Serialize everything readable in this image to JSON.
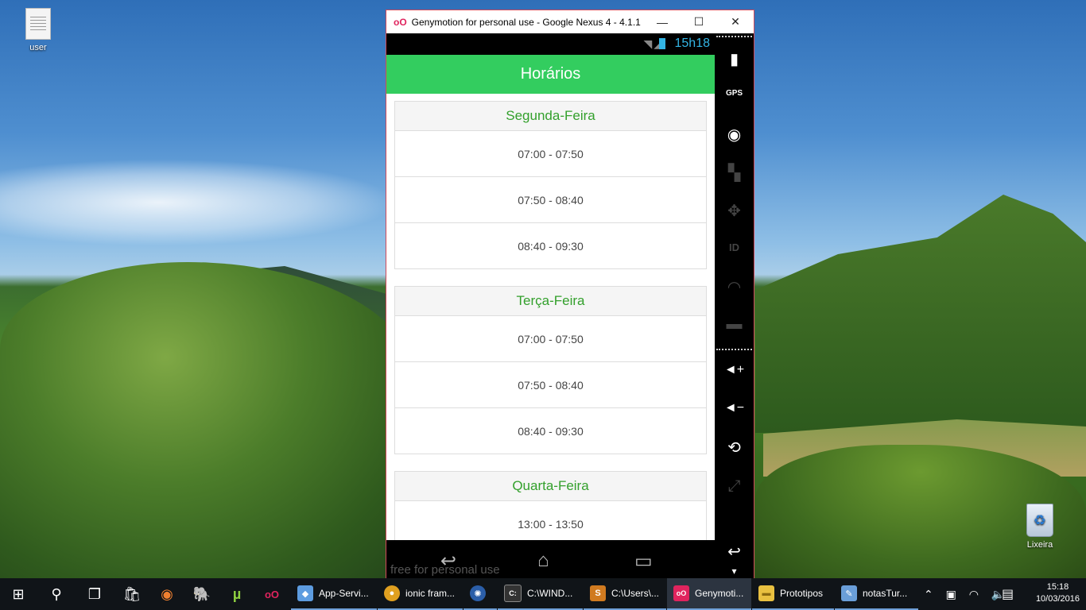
{
  "desktop": {
    "icons": [
      {
        "label": "user",
        "icon": "document-icon"
      },
      {
        "label": "Lixeira",
        "icon": "recycle-bin-icon"
      }
    ]
  },
  "window": {
    "app_icon": "oO",
    "title": "Genymotion for personal use - Google Nexus 4 - 4.1.1 ...",
    "minimize": "—",
    "maximize": "☐",
    "close": "✕"
  },
  "phone": {
    "status": {
      "time": "15h18",
      "icons": "wifi signal battery"
    },
    "header_title": "Horários",
    "days": [
      {
        "name": "Segunda-Feira",
        "slots": [
          "07:00 - 07:50",
          "07:50 - 08:40",
          "08:40 - 09:30"
        ]
      },
      {
        "name": "Terça-Feira",
        "slots": [
          "07:00 - 07:50",
          "07:50 - 08:40",
          "08:40 - 09:30"
        ]
      },
      {
        "name": "Quarta-Feira",
        "slots": [
          "13:00 - 13:50"
        ]
      }
    ],
    "nav": {
      "back": "↩",
      "home": "⌂",
      "recents": "▭"
    },
    "watermark": "free for personal use"
  },
  "sidebar": {
    "buttons": [
      {
        "name": "battery-icon",
        "glyph": "▮",
        "enabled": true
      },
      {
        "name": "gps-icon",
        "glyph": "GPS",
        "enabled": true
      },
      {
        "name": "camera-icon",
        "glyph": "◉",
        "enabled": true
      },
      {
        "name": "video-capture-icon",
        "glyph": "▚",
        "enabled": false
      },
      {
        "name": "dpad-icon",
        "glyph": "✥",
        "enabled": false
      },
      {
        "name": "device-id-icon",
        "glyph": "ID",
        "enabled": false
      },
      {
        "name": "network-icon",
        "glyph": "◠",
        "enabled": false
      },
      {
        "name": "sms-icon",
        "glyph": "▬",
        "enabled": false
      },
      {
        "name": "volume-up-icon",
        "glyph": "◄+",
        "enabled": true
      },
      {
        "name": "volume-down-icon",
        "glyph": "◄−",
        "enabled": true
      },
      {
        "name": "rotate-icon",
        "glyph": "⟲",
        "enabled": true
      },
      {
        "name": "pixel-perfect-icon",
        "glyph": "⤢",
        "enabled": false
      },
      {
        "name": "back-icon",
        "glyph": "↩",
        "enabled": true
      },
      {
        "name": "menu-icon",
        "glyph": "▾",
        "enabled": true
      }
    ]
  },
  "taskbar": {
    "start": "⊞",
    "search": "⚲",
    "task_view": "❐",
    "pinned": [
      {
        "name": "store-icon",
        "glyph": "🛍"
      },
      {
        "name": "firefox-icon",
        "glyph": "◉"
      },
      {
        "name": "postgres-icon",
        "glyph": "🐘"
      },
      {
        "name": "utorrent-icon",
        "glyph": "µ"
      },
      {
        "name": "genymotion-pinned-icon",
        "glyph": "oO"
      }
    ],
    "apps": [
      {
        "label": "App-Servi...",
        "icon": "virtualbox-icon",
        "glyph": "◆",
        "color": "#5d9ce0",
        "active": false
      },
      {
        "label": "ionic fram...",
        "icon": "chrome-icon",
        "glyph": "●",
        "color": "#e0a020",
        "active": false
      },
      {
        "label": "",
        "icon": "sourcetree-icon",
        "glyph": "✺",
        "color": "#2b5ea8",
        "active": false
      },
      {
        "label": "C:\\WIND...",
        "icon": "cmd-icon",
        "glyph": "C:",
        "color": "#333333",
        "active": false
      },
      {
        "label": "C:\\Users\\...",
        "icon": "sublime-icon",
        "glyph": "S",
        "color": "#d07a20",
        "active": false
      },
      {
        "label": "Genymoti...",
        "icon": "genymotion-icon",
        "glyph": "oO",
        "color": "#e0245e",
        "active": true
      },
      {
        "label": "Prototipos",
        "icon": "folder-icon",
        "glyph": "▬",
        "color": "#e8c040",
        "active": false
      },
      {
        "label": "notasTur...",
        "icon": "paint-icon",
        "glyph": "✎",
        "color": "#6a9ed8",
        "active": false
      }
    ],
    "tray_icons": "⌃ ▣ ◠ 🔈",
    "notification": "▤",
    "time": "15:18",
    "date": "10/03/2016"
  }
}
